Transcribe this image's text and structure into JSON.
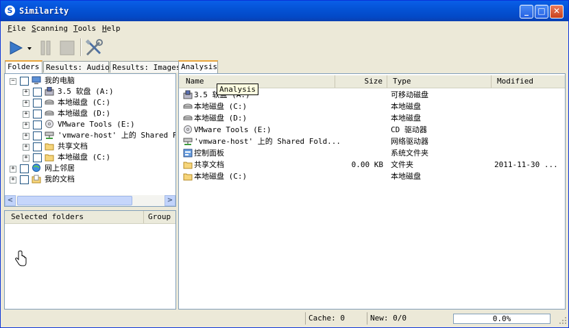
{
  "window": {
    "title": "Similarity"
  },
  "menu": [
    "File",
    "Scanning",
    "Tools",
    "Help"
  ],
  "toolbar": {
    "buttons": [
      "play-icon",
      "dropdown-arrow-icon",
      "pause-icon",
      "stop-icon",
      "tools-icon"
    ]
  },
  "left_tabs": [
    "Folders",
    "Results: Audio",
    "Results: Images"
  ],
  "right_tabs": [
    "Analysis"
  ],
  "tooltip": "Analysis",
  "tree": [
    {
      "label": "我的电脑",
      "icon": "computer-icon",
      "indent": 0,
      "expander": "-"
    },
    {
      "label": "3.5 软盘 (A:)",
      "icon": "floppy-drive-icon",
      "indent": 1,
      "expander": "+"
    },
    {
      "label": "本地磁盘 (C:)",
      "icon": "hard-drive-icon",
      "indent": 1,
      "expander": "+"
    },
    {
      "label": "本地磁盘 (D:)",
      "icon": "hard-drive-icon",
      "indent": 1,
      "expander": "+"
    },
    {
      "label": "VMware Tools (E:)",
      "icon": "cd-drive-icon",
      "indent": 1,
      "expander": "+"
    },
    {
      "label": "'vmware-host' 上的 Shared Fo",
      "icon": "network-drive-icon",
      "indent": 1,
      "expander": "+"
    },
    {
      "label": "共享文档",
      "icon": "folder-icon",
      "indent": 1,
      "expander": "+"
    },
    {
      "label": "本地磁盘 (C:)",
      "icon": "folder-icon",
      "indent": 1,
      "expander": "+"
    },
    {
      "label": "网上邻居",
      "icon": "network-places-icon",
      "indent": 0,
      "expander": "+"
    },
    {
      "label": "我的文档",
      "icon": "my-documents-icon",
      "indent": 0,
      "expander": "+"
    }
  ],
  "selected_folders": {
    "columns": [
      "Selected folders",
      "Group"
    ]
  },
  "analysis": {
    "columns": [
      "Name",
      "Size",
      "Type",
      "Modified"
    ],
    "rows": [
      {
        "name": "3.5 软盘 (A:)",
        "size": "",
        "type": "可移动磁盘",
        "modified": "",
        "icon": "floppy-drive-icon"
      },
      {
        "name": "本地磁盘 (C:)",
        "size": "",
        "type": "本地磁盘",
        "modified": "",
        "icon": "hard-drive-icon"
      },
      {
        "name": "本地磁盘 (D:)",
        "size": "",
        "type": "本地磁盘",
        "modified": "",
        "icon": "hard-drive-icon"
      },
      {
        "name": "VMware Tools (E:)",
        "size": "",
        "type": "CD 驱动器",
        "modified": "",
        "icon": "cd-drive-icon"
      },
      {
        "name": "'vmware-host' 上的 Shared Fold...",
        "size": "",
        "type": "网络驱动器",
        "modified": "",
        "icon": "network-drive-icon"
      },
      {
        "name": "控制面板",
        "size": "",
        "type": "系统文件夹",
        "modified": "",
        "icon": "control-panel-icon"
      },
      {
        "name": "共享文档",
        "size": "0.00 KB",
        "type": "文件夹",
        "modified": "2011-11-30 ...",
        "icon": "folder-icon"
      },
      {
        "name": "本地磁盘 (C:)",
        "size": "",
        "type": "本地磁盘",
        "modified": "",
        "icon": "folder-icon"
      }
    ]
  },
  "status": {
    "cache": "Cache: 0",
    "new": "New: 0/0",
    "progress_text": "0.0%",
    "progress": 0.0
  },
  "colors": {
    "title_bar": "#0453d6",
    "tab_accent": "#e8a33a",
    "tooltip_bg": "#ffffe1"
  }
}
